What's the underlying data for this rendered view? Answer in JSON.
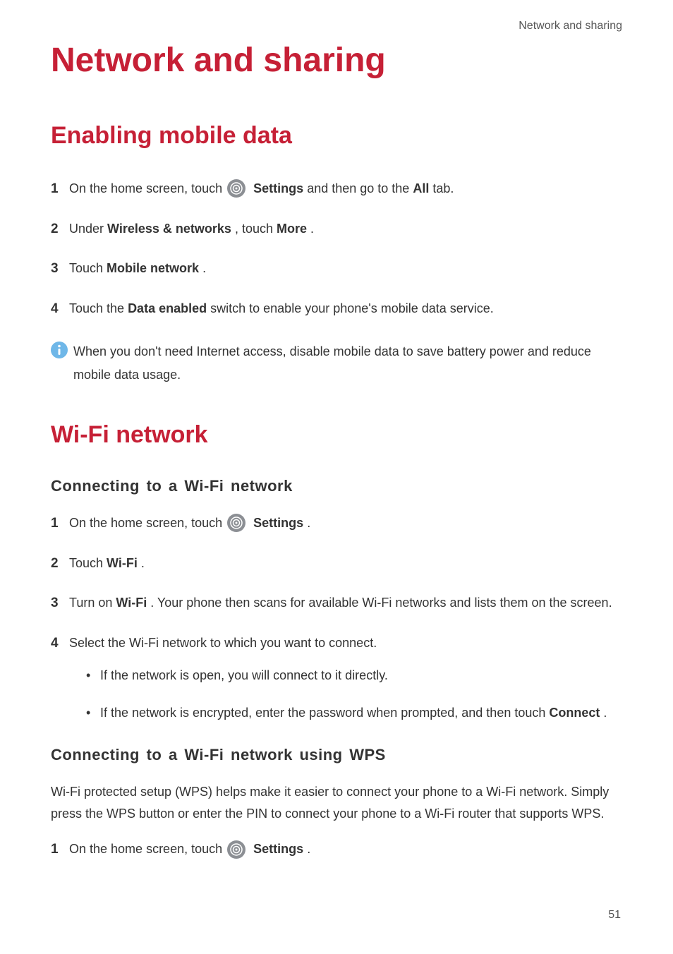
{
  "header": {
    "label": "Network and sharing"
  },
  "title": "Network and sharing",
  "section1": {
    "title": "Enabling mobile data",
    "steps": [
      {
        "num": "1",
        "pre": "On the home screen, touch ",
        "bold1": "Settings",
        "mid": " and then go to the ",
        "bold2": "All",
        "post": " tab."
      },
      {
        "num": "2",
        "pre": "Under ",
        "bold1": "Wireless & networks",
        "mid": ", touch ",
        "bold2": "More",
        "post": "."
      },
      {
        "num": "3",
        "pre": "Touch ",
        "bold1": "Mobile network",
        "post": "."
      },
      {
        "num": "4",
        "pre": "Touch the ",
        "bold1": "Data enabled",
        "post": " switch to enable your phone's mobile data service."
      }
    ],
    "info": "When you don't need Internet access, disable mobile data to save battery power and reduce mobile data usage."
  },
  "section2": {
    "title": "Wi-Fi network",
    "sub1": {
      "title": "Connecting to a Wi-Fi network",
      "steps": [
        {
          "num": "1",
          "pre": "On the home screen, touch ",
          "bold1": "Settings",
          "post": "."
        },
        {
          "num": "2",
          "pre": "Touch ",
          "bold1": "Wi-Fi",
          "post": "."
        },
        {
          "num": "3",
          "pre": "Turn on ",
          "bold1": "Wi-Fi",
          "post": ". Your phone then scans for available Wi-Fi networks and lists them on the screen."
        },
        {
          "num": "4",
          "pre": "Select the Wi-Fi network to which you want to connect.",
          "bullets": [
            {
              "text": "If the network is open, you will connect to it directly."
            },
            {
              "pre": "If the network is encrypted, enter the password when prompted, and then touch ",
              "bold1": "Connect",
              "post": "."
            }
          ]
        }
      ]
    },
    "sub2": {
      "title": "Connecting to a Wi-Fi network using WPS",
      "intro": "Wi-Fi protected setup (WPS) helps make it easier to connect your phone to a Wi-Fi network. Simply press the WPS button or enter the PIN to connect your phone to a Wi-Fi router that supports WPS.",
      "steps": [
        {
          "num": "1",
          "pre": "On the home screen, touch ",
          "bold1": "Settings",
          "post": "."
        }
      ]
    }
  },
  "page_number": "51"
}
